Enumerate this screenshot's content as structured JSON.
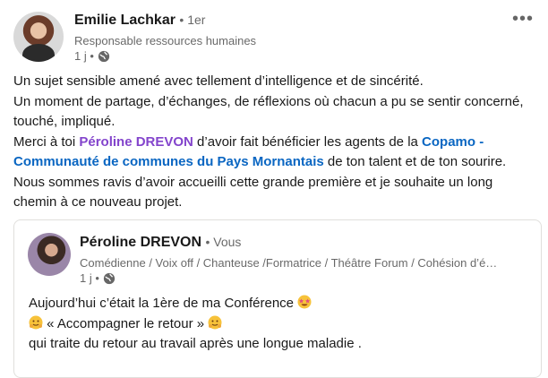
{
  "post": {
    "author_name": "Emilie Lachkar",
    "degree": "• 1er",
    "headline": "Responsable ressources humaines",
    "time": "1 j •",
    "menu_label": "•••",
    "text": {
      "line1": "Un sujet sensible amené avec tellement d’intelligence et de sincérité.",
      "line2": "Un moment de partage, d’échanges, de réflexions où chacun a pu se sentir concerné, touché, impliqué.",
      "line3_prefix": "Merci à toi ",
      "mention": "Péroline DREVON",
      "line3_mid": " d’avoir fait bénéficier les agents de la ",
      "company": "Copamo - Communauté de communes du Pays Mornantais",
      "line3_suffix": " de ton talent et de ton sourire.",
      "line4": "Nous sommes ravis d’avoir accueilli cette grande première et je souhaite un long chemin à ce nouveau projet."
    }
  },
  "shared": {
    "author_name": "Péroline DREVON",
    "you": "• Vous",
    "headline": "Comédienne / Voix off / Chanteuse /Formatrice / Théâtre Forum / Cohésion d’é…",
    "time": "1 j •",
    "text": {
      "line1": "Aujourd’hui c’était la 1ère de ma Conférence",
      "line2": "« Accompagner le retour »",
      "line3": "qui traite du retour au travail après une longue maladie ."
    }
  },
  "icons": {
    "globe": "globe-icon",
    "menu": "ellipsis-icon",
    "emoji_heart_eyes": "star-struck-emoji",
    "emoji_hug": "hugging-emoji"
  },
  "colors": {
    "mention": "#8344cc",
    "company": "#0a66c2",
    "secondary_text": "#666666"
  }
}
